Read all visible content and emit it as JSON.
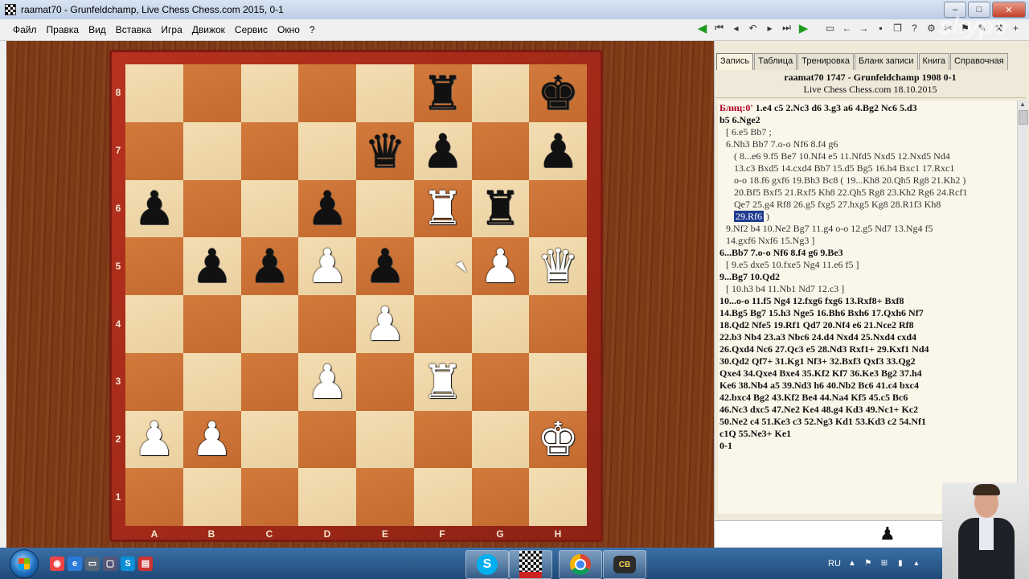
{
  "window": {
    "title": "raamat70 - Grunfeldchamp, Live Chess Chess.com 2015, 0-1",
    "buttons": [
      "–",
      "□",
      "✕"
    ]
  },
  "menu": [
    "Файл",
    "Правка",
    "Вид",
    "Вставка",
    "Игра",
    "Движок",
    "Сервис",
    "Окно",
    "?"
  ],
  "toolbar_icons": [
    "green-back-icon",
    "first-move-icon",
    "prev-move-icon",
    "undo-icon",
    "next-move-icon",
    "last-move-icon",
    "green-forward-icon",
    "new-doc-icon",
    "back-icon",
    "forward-icon",
    "save-icon",
    "copy-icon",
    "help-icon",
    "settings-icon",
    "tools-icon",
    "flag-icon",
    "edit-icon",
    "options-icon",
    "print-icon",
    "add-icon"
  ],
  "board": {
    "ranks": [
      "8",
      "7",
      "6",
      "5",
      "4",
      "3",
      "2",
      "1"
    ],
    "files": [
      "A",
      "B",
      "C",
      "D",
      "E",
      "F",
      "G",
      "H"
    ],
    "squares": [
      [
        "",
        "",
        "",
        "",
        "",
        "br",
        "",
        "bk"
      ],
      [
        "",
        "",
        "",
        "",
        "bq",
        "bp",
        "",
        "bp"
      ],
      [
        "bp",
        "",
        "",
        "bp",
        "",
        "wr",
        "br",
        ""
      ],
      [
        "",
        "bp",
        "bp",
        "wp",
        "bp",
        "",
        "wp",
        "wq"
      ],
      [
        "",
        "",
        "",
        "",
        "wp",
        "",
        "",
        ""
      ],
      [
        "",
        "",
        "",
        "wp",
        "",
        "wr",
        "",
        ""
      ],
      [
        "wp",
        "wp",
        "",
        "",
        "",
        "",
        "",
        "wk"
      ],
      [
        "",
        "",
        "",
        "",
        "",
        "",
        "",
        ""
      ]
    ]
  },
  "panel": {
    "tabs": [
      "Запись",
      "Таблица",
      "Тренировка",
      "Бланк записи",
      "Книга",
      "Справочная"
    ],
    "active_tab": "Запись",
    "header_line1": "raamat70 1747 - Grunfeldchamp 1908  0-1",
    "header_line2": "Live Chess Chess.com 18.10.2015",
    "notation": [
      {
        "cls": "main",
        "text": "Блиц:0'  1.e4 c5 2.Nc3 d6 3.g3 a6 4.Bg2 Nc6 5.d3"
      },
      {
        "cls": "main",
        "text": "b5 6.Nge2"
      },
      {
        "cls": "var1",
        "text": "[ 6.e5 Bb7 ;"
      },
      {
        "cls": "var1",
        "text": "6.Nh3 Bb7 7.o-o Nf6 8.f4 g6"
      },
      {
        "cls": "var2",
        "text": "( 8...e6 9.f5 Be7 10.Nf4 e5 11.Nfd5 Nxd5 12.Nxd5 Nd4"
      },
      {
        "cls": "var2",
        "text": "13.c3 Bxd5 14.cxd4 Bb7 15.d5 Bg5 16.h4 Bxc1 17.Rxc1"
      },
      {
        "cls": "var2",
        "text": "o-o 18.f6 gxf6 19.Bh3 Bc8 ( 19...Kh8 20.Qh5 Rg8 21.Kh2 )"
      },
      {
        "cls": "var2",
        "text": "20.Bf5 Bxf5 21.Rxf5 Kh8 22.Qh5 Rg8 23.Kh2 Rg6 24.Rcf1"
      },
      {
        "cls": "var2",
        "text": "Qe7 25.g4 Rf8 26.g5 fxg5 27.hxg5 Kg8 28.R1f3 Kh8"
      },
      {
        "cls": "var2",
        "text": "29.Rf6 )",
        "hl": "29.Rf6"
      },
      {
        "cls": "var1",
        "text": "9.Nf2 b4 10.Ne2 Bg7 11.g4 o-o 12.g5 Nd7 13.Ng4 f5"
      },
      {
        "cls": "var1",
        "text": "14.gxf6 Nxf6 15.Ng3 ]"
      },
      {
        "cls": "main",
        "text": "6...Bb7 7.o-o Nf6 8.f4 g6 9.Be3"
      },
      {
        "cls": "var1",
        "text": "[ 9.e5 dxe5 10.fxe5 Ng4 11.e6 f5 ]"
      },
      {
        "cls": "main",
        "text": "9...Bg7 10.Qd2"
      },
      {
        "cls": "var1",
        "text": "[ 10.h3 b4 11.Nb1 Nd7 12.c3 ]"
      },
      {
        "cls": "main",
        "text": "10...o-o 11.f5 Ng4 12.fxg6 fxg6 13.Rxf8+ Bxf8"
      },
      {
        "cls": "main",
        "text": "14.Bg5 Bg7 15.h3 Nge5 16.Bh6 Bxh6 17.Qxh6 Nf7"
      },
      {
        "cls": "main",
        "text": "18.Qd2 Nfe5 19.Rf1 Qd7 20.Nf4 e6 21.Nce2 Rf8"
      },
      {
        "cls": "main",
        "text": "22.b3 Nb4 23.a3 Nbc6 24.d4 Nxd4 25.Nxd4 cxd4"
      },
      {
        "cls": "main",
        "text": "26.Qxd4 Nc6 27.Qc3 e5 28.Nd3 Rxf1+ 29.Kxf1 Nd4"
      },
      {
        "cls": "main",
        "text": "30.Qd2 Qf7+ 31.Kg1 Nf3+ 32.Bxf3 Qxf3 33.Qg2"
      },
      {
        "cls": "main",
        "text": "Qxe4 34.Qxe4 Bxe4 35.Kf2 Kf7 36.Ke3 Bg2 37.h4"
      },
      {
        "cls": "main",
        "text": "Ke6 38.Nb4 a5 39.Nd3 h6 40.Nb2 Bc6 41.c4 bxc4"
      },
      {
        "cls": "main",
        "text": "42.bxc4 Bg2 43.Kf2 Be4 44.Na4 Kf5 45.c5 Bc6"
      },
      {
        "cls": "main",
        "text": "46.Nc3 dxc5 47.Ne2 Ke4 48.g4 Kd3 49.Nc1+ Kc2"
      },
      {
        "cls": "main",
        "text": "50.Ne2 c4 51.Ke3 c3 52.Ng3 Kd1 53.Kd3 c2 54.Nf1"
      },
      {
        "cls": "main",
        "text": "c1Q 55.Ne3+ Ke1"
      },
      {
        "cls": "main",
        "text": "0-1"
      }
    ]
  },
  "watermark": "skype",
  "taskbar": {
    "tray_lang": "RU",
    "pinned": [
      "skype-app",
      "chessbase-app",
      "chrome-app",
      "chessbase12-app"
    ]
  }
}
